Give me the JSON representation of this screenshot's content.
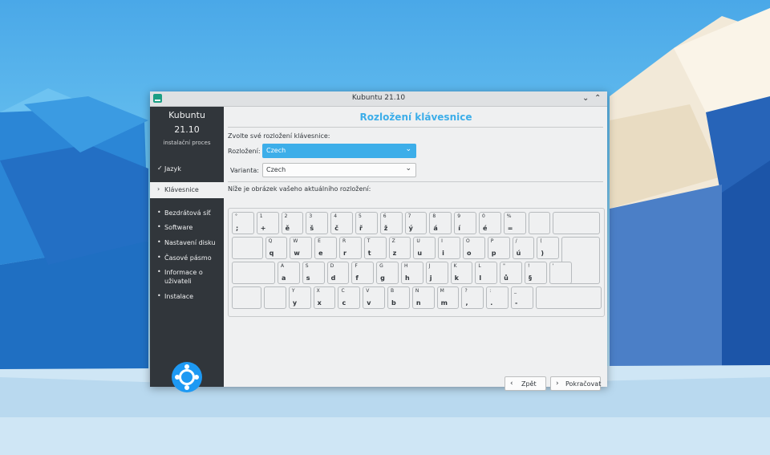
{
  "window": {
    "title": "Kubuntu 21.10",
    "minimize_glyph": "⌄",
    "maximize_glyph": "⌃"
  },
  "sidebar": {
    "product": "Kubuntu",
    "version": "21.10",
    "subtitle": "instalační proces",
    "steps": [
      {
        "label": "Jazyk",
        "mark": "✓",
        "state": "done"
      },
      {
        "label": "Klávesnice",
        "mark": "›",
        "state": "current"
      },
      {
        "label": "Bezdrátová síť",
        "mark": "•",
        "state": "todo"
      },
      {
        "label": "Software",
        "mark": "•",
        "state": "todo"
      },
      {
        "label": "Nastavení disku",
        "mark": "•",
        "state": "todo"
      },
      {
        "label": "Časové pásmo",
        "mark": "•",
        "state": "todo"
      },
      {
        "label": "Informace o uživateli",
        "mark": "•",
        "state": "todo"
      },
      {
        "label": "Instalace",
        "mark": "•",
        "state": "todo"
      }
    ]
  },
  "main": {
    "title": "Rozložení klávesnice",
    "prompt": "Zvolte své rozložení klávesnice:",
    "layout_label": "Rozložení:",
    "layout_value": "Czech",
    "variant_label": "Varianta:",
    "variant_value": "Czech",
    "preview_caption": "Níže je obrázek vašeho aktuálního rozložení:"
  },
  "keyboard": {
    "rows": [
      [
        {
          "up": "°",
          "lo": ";"
        },
        {
          "up": "1",
          "lo": "+"
        },
        {
          "up": "2",
          "lo": "ě"
        },
        {
          "up": "3",
          "lo": "š"
        },
        {
          "up": "4",
          "lo": "č"
        },
        {
          "up": "5",
          "lo": "ř"
        },
        {
          "up": "6",
          "lo": "ž"
        },
        {
          "up": "7",
          "lo": "ý"
        },
        {
          "up": "8",
          "lo": "á"
        },
        {
          "up": "9",
          "lo": "í"
        },
        {
          "up": "0",
          "lo": "é"
        },
        {
          "up": "%",
          "lo": "="
        },
        {
          "up": "",
          "lo": ""
        },
        {
          "up": "",
          "lo": ""
        }
      ],
      [
        {
          "up": "",
          "lo": ""
        },
        {
          "up": "Q",
          "lo": "q"
        },
        {
          "up": "W",
          "lo": "w"
        },
        {
          "up": "E",
          "lo": "e"
        },
        {
          "up": "R",
          "lo": "r"
        },
        {
          "up": "T",
          "lo": "t"
        },
        {
          "up": "Z",
          "lo": "z"
        },
        {
          "up": "U",
          "lo": "u"
        },
        {
          "up": "I",
          "lo": "i"
        },
        {
          "up": "O",
          "lo": "o"
        },
        {
          "up": "P",
          "lo": "p"
        },
        {
          "up": "/",
          "lo": "ú"
        },
        {
          "up": "(",
          "lo": ")"
        },
        {
          "up": "",
          "lo": ""
        }
      ],
      [
        {
          "up": "",
          "lo": ""
        },
        {
          "up": "A",
          "lo": "a"
        },
        {
          "up": "S",
          "lo": "s"
        },
        {
          "up": "D",
          "lo": "d"
        },
        {
          "up": "F",
          "lo": "f"
        },
        {
          "up": "G",
          "lo": "g"
        },
        {
          "up": "H",
          "lo": "h"
        },
        {
          "up": "J",
          "lo": "j"
        },
        {
          "up": "K",
          "lo": "k"
        },
        {
          "up": "L",
          "lo": "l"
        },
        {
          "up": "\"",
          "lo": "ů"
        },
        {
          "up": "!",
          "lo": "§"
        },
        {
          "up": "'",
          "lo": ""
        }
      ],
      [
        {
          "up": "",
          "lo": ""
        },
        {
          "up": "",
          "lo": ""
        },
        {
          "up": "Y",
          "lo": "y"
        },
        {
          "up": "X",
          "lo": "x"
        },
        {
          "up": "C",
          "lo": "c"
        },
        {
          "up": "V",
          "lo": "v"
        },
        {
          "up": "B",
          "lo": "b"
        },
        {
          "up": "N",
          "lo": "n"
        },
        {
          "up": "M",
          "lo": "m"
        },
        {
          "up": "?",
          "lo": ","
        },
        {
          "up": ":",
          "lo": "."
        },
        {
          "up": "_",
          "lo": "-"
        },
        {
          "up": "",
          "lo": ""
        }
      ]
    ]
  },
  "buttons": {
    "back_label": "Zpět",
    "back_icon": "‹",
    "next_label": "Pokračovat",
    "next_icon": "›"
  },
  "colors": {
    "accent": "#3daee9",
    "sidebar": "#31363b",
    "window": "#eff0f1"
  },
  "icons": {
    "app": "kubuntu-app-icon",
    "logo": "kubuntu-logo-icon"
  }
}
